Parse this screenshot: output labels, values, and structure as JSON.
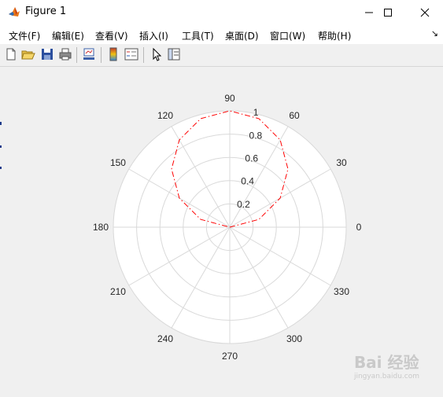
{
  "window": {
    "title": "Figure 1"
  },
  "menu": [
    {
      "label": "文件(F)"
    },
    {
      "label": "编辑(E)"
    },
    {
      "label": "查看(V)"
    },
    {
      "label": "插入(I)"
    },
    {
      "label": "工具(T)"
    },
    {
      "label": "桌面(D)"
    },
    {
      "label": "窗口(W)"
    },
    {
      "label": "帮助(H)"
    }
  ],
  "toolbar": {
    "buttons": [
      "new-figure",
      "open-file",
      "save",
      "print",
      "link-plot",
      "insert-colorbar",
      "insert-legend",
      "edit-plot",
      "property-inspector"
    ]
  },
  "watermark": {
    "text": "Bai 经验",
    "sub": "jingyan.baidu.com"
  },
  "chart_data": {
    "type": "line",
    "coordinate_system": "polar",
    "angle_ticks": [
      "0",
      "30",
      "60",
      "90",
      "120",
      "150",
      "180",
      "210",
      "240",
      "270",
      "300",
      "330"
    ],
    "radial_ticks": [
      "0.2",
      "0.4",
      "0.6",
      "0.8",
      "1"
    ],
    "rlim": [
      0,
      1
    ],
    "grid": true,
    "series": [
      {
        "line_style": "dash-dot",
        "color": "#ff0000",
        "theta_deg": [
          0,
          15,
          30,
          45,
          60,
          75,
          90,
          105,
          120,
          135,
          150,
          165,
          180
        ],
        "r": [
          0,
          0.259,
          0.5,
          0.707,
          0.866,
          0.966,
          1,
          0.966,
          0.866,
          0.707,
          0.5,
          0.259,
          0
        ]
      }
    ]
  },
  "colors": {
    "curve": "#ff0000",
    "grid": "#d9d9d9",
    "axes_bg": "#ffffff",
    "figure_bg": "#f0f0f0"
  }
}
